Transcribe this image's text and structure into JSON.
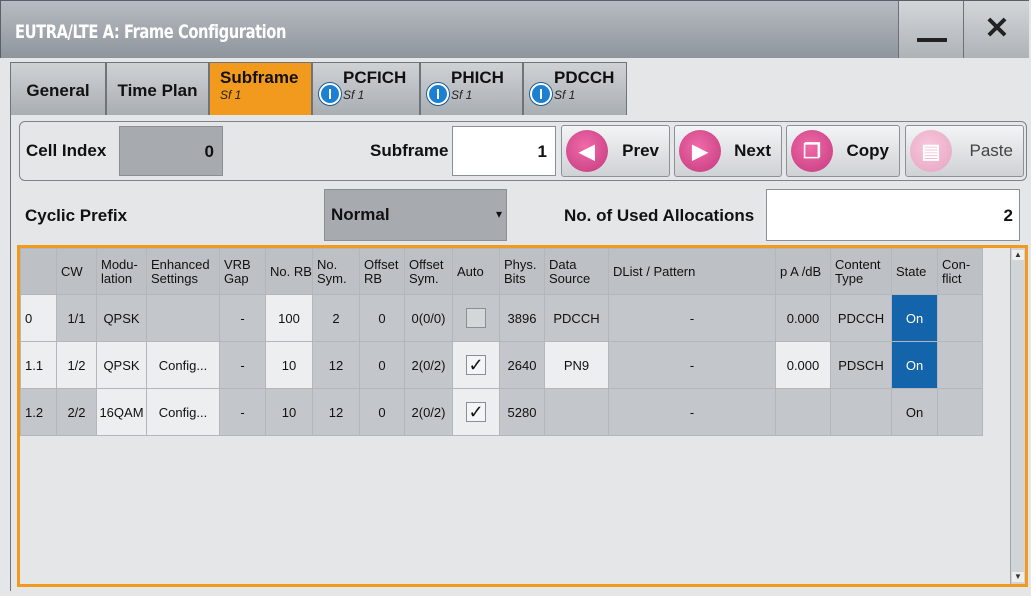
{
  "window": {
    "title": "EUTRA/LTE A: Frame Configuration"
  },
  "tabs": [
    {
      "label": "General"
    },
    {
      "label": "Time Plan"
    },
    {
      "label": "Subframe",
      "sub": "Sf 1"
    },
    {
      "label": "PCFICH",
      "sub": "Sf 1"
    },
    {
      "label": "PHICH",
      "sub": "Sf 1"
    },
    {
      "label": "PDCCH",
      "sub": "Sf 1"
    }
  ],
  "controls": {
    "cell_index_label": "Cell Index",
    "cell_index_value": "0",
    "subframe_label": "Subframe",
    "subframe_value": "1",
    "prev_label": "Prev",
    "next_label": "Next",
    "copy_label": "Copy",
    "paste_label": "Paste",
    "cyclic_prefix_label": "Cyclic Prefix",
    "cyclic_prefix_value": "Normal",
    "allocations_label": "No. of Used Allocations",
    "allocations_value": "2"
  },
  "table": {
    "headers": [
      "",
      "CW",
      "Modu-\nlation",
      "Enhanced Settings",
      "VRB Gap",
      "No. RB",
      "No. Sym.",
      "Offset RB",
      "Offset Sym.",
      "Auto",
      "Phys. Bits",
      "Data Source",
      "DList / Pattern",
      "p A /dB",
      "Content Type",
      "State",
      "Con-\nflict"
    ],
    "rows": [
      {
        "idx": "0",
        "cw": "1/1",
        "mod": "QPSK",
        "enh": "",
        "vrb": "-",
        "rb": "100",
        "sym": "2",
        "orb": "0",
        "osym": "0(0/0)",
        "auto": "",
        "bits": "3896",
        "src": "PDCCH",
        "dlist": "-",
        "pa": "0.000",
        "ctype": "PDCCH",
        "state": "On",
        "conflict": ""
      },
      {
        "idx": "1.1",
        "cw": "1/2",
        "mod": "QPSK",
        "enh": "Config...",
        "vrb": "-",
        "rb": "10",
        "sym": "12",
        "orb": "0",
        "osym": "2(0/2)",
        "auto": "✓",
        "bits": "2640",
        "src": "PN9",
        "dlist": "-",
        "pa": "0.000",
        "ctype": "PDSCH",
        "state": "On",
        "conflict": ""
      },
      {
        "idx": "1.2",
        "cw": "2/2",
        "mod": "16QAM",
        "enh": "Config...",
        "vrb": "-",
        "rb": "10",
        "sym": "12",
        "orb": "0",
        "osym": "2(0/2)",
        "auto": "✓",
        "bits": "5280",
        "src": "",
        "dlist": "-",
        "pa": "",
        "ctype": "",
        "state": "On",
        "conflict": ""
      }
    ]
  },
  "colors": {
    "accent": "#f29a1e",
    "state_on": "#1464ac",
    "button_icon": "#d84a8e"
  }
}
